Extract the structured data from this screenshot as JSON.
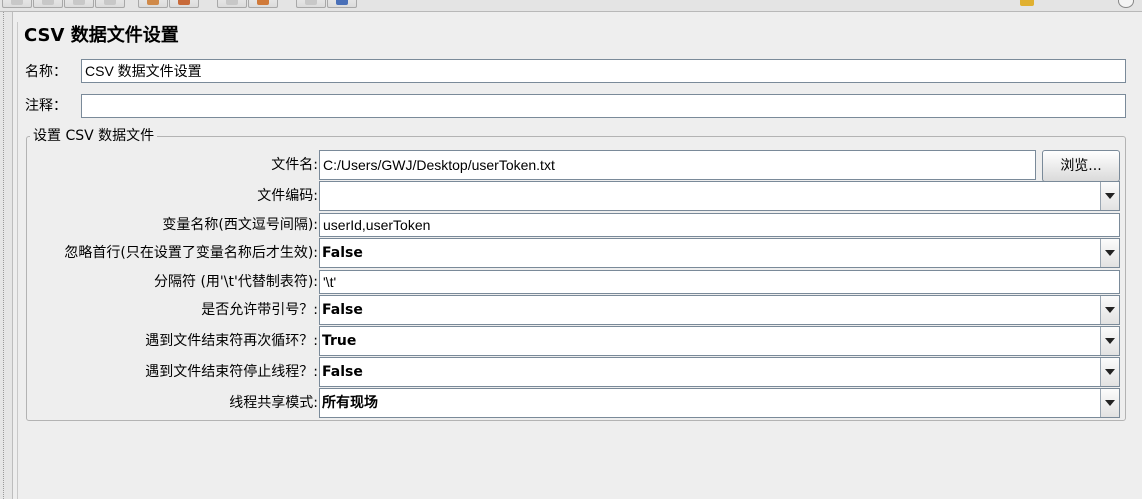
{
  "title": "CSV 数据文件设置",
  "name": {
    "label": "名称：",
    "value": "CSV 数据文件设置"
  },
  "comment": {
    "label": "注释：",
    "value": ""
  },
  "group": {
    "title": "设置 CSV 数据文件",
    "filename": {
      "label": "文件名:",
      "value": "C:/Users/GWJ/Desktop/userToken.txt"
    },
    "browse_label": "浏览...",
    "encoding": {
      "label": "文件编码:",
      "value": ""
    },
    "variable_names": {
      "label": "变量名称(西文逗号间隔):",
      "value": "userId,userToken"
    },
    "ignore_first_line": {
      "label": "忽略首行(只在设置了变量名称后才生效):",
      "value": "False"
    },
    "delimiter": {
      "label": "分隔符 (用'\\t'代替制表符):",
      "value": "'\\t'"
    },
    "allow_quoted": {
      "label": "是否允许带引号？:",
      "value": "False"
    },
    "recycle_on_eof": {
      "label": "遇到文件结束符再次循环？:",
      "value": "True"
    },
    "stop_thread_on_eof": {
      "label": "遇到文件结束符停止线程？:",
      "value": "False"
    },
    "sharing_mode": {
      "label": "线程共享模式:",
      "value": "所有现场"
    }
  },
  "icons": {
    "toolbar": [
      "toolbar-button-icon",
      "toolbar-button-icon",
      "toolbar-button-icon",
      "toolbar-button-icon",
      "toolbar-button-icon",
      "toolbar-button-icon",
      "toolbar-button-icon",
      "toolbar-button-icon"
    ],
    "dropdown": "chevron-down-icon"
  },
  "colors": {
    "panel_background": "#eeeeee",
    "field_border": "#7a8a99",
    "warning_icon": "#e0b030"
  }
}
